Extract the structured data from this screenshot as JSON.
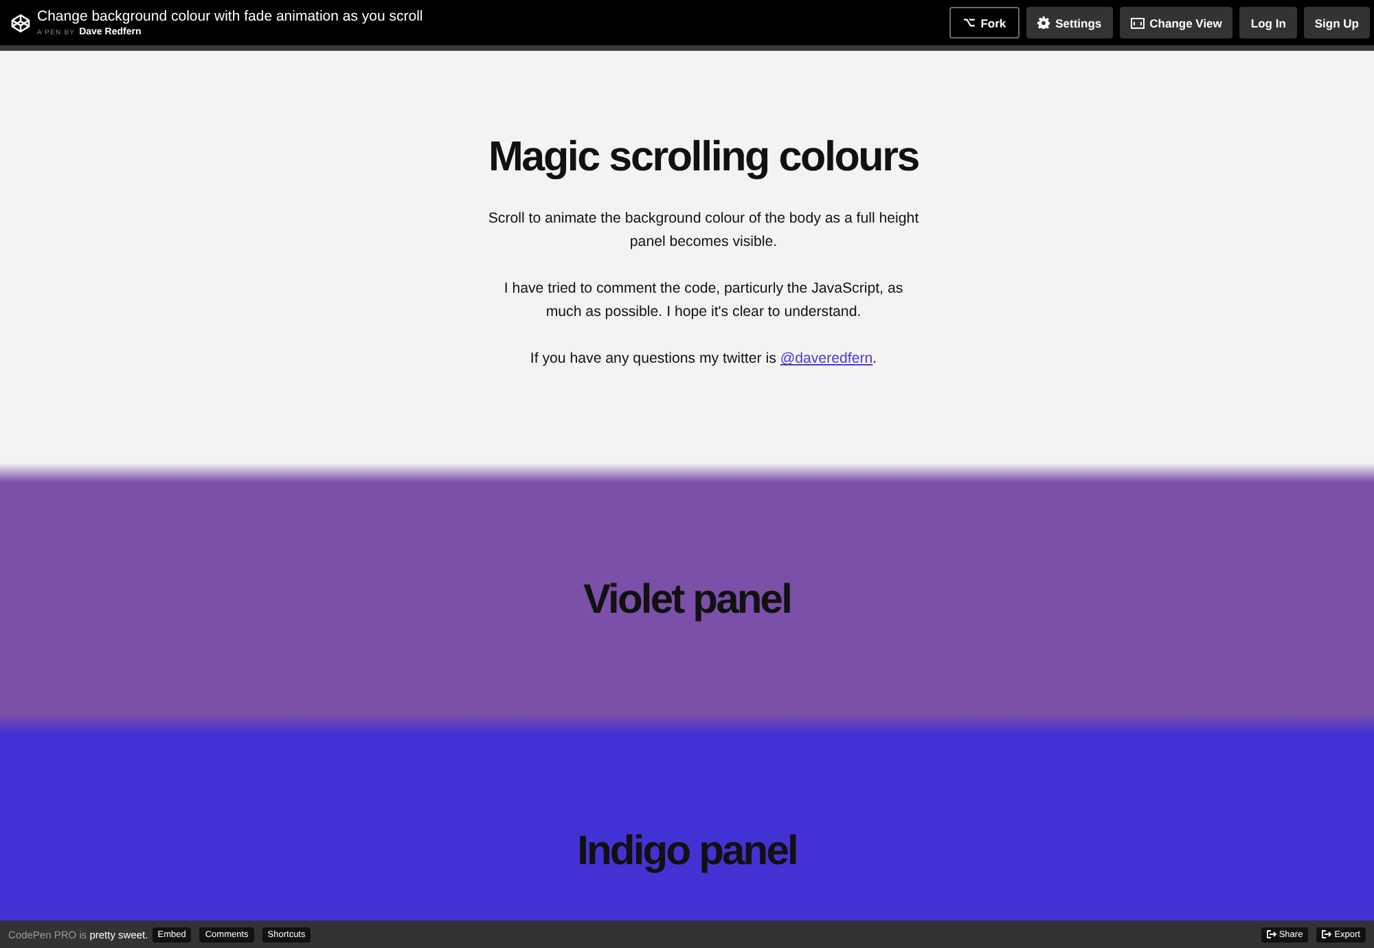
{
  "header": {
    "title": "Change background colour with fade animation as you scroll",
    "byline_label": "A PEN BY",
    "author": "Dave Redfern",
    "buttons": [
      {
        "label": "Fork",
        "kind": "fork"
      },
      {
        "label": "Settings",
        "kind": "settings"
      },
      {
        "label": "Change View",
        "kind": "view"
      },
      {
        "label": "Log In",
        "kind": "plain"
      },
      {
        "label": "Sign Up",
        "kind": "plain"
      }
    ]
  },
  "intro": {
    "title": "Magic scrolling colours",
    "paragraphs": [
      "Scroll to animate the background colour of the body as a full height panel becomes visible.",
      "I have tried to comment the code, particurly the JavaScript, as much as possible. I hope it's clear to understand."
    ],
    "contact": {
      "text": "If you have any questions my twitter is",
      "link": "@daveredfern",
      "after": "."
    }
  },
  "panels": [
    {
      "title": "Violet panel",
      "color": "#7b50a8"
    },
    {
      "title": "Indigo panel",
      "color": "#4332d3"
    }
  ],
  "footer": {
    "promo": "CodePen PRO is **pretty sweet.**",
    "buttons": [
      "Embed",
      "Comments",
      "Shortcuts"
    ],
    "actions": [
      "Share",
      "Export"
    ]
  }
}
